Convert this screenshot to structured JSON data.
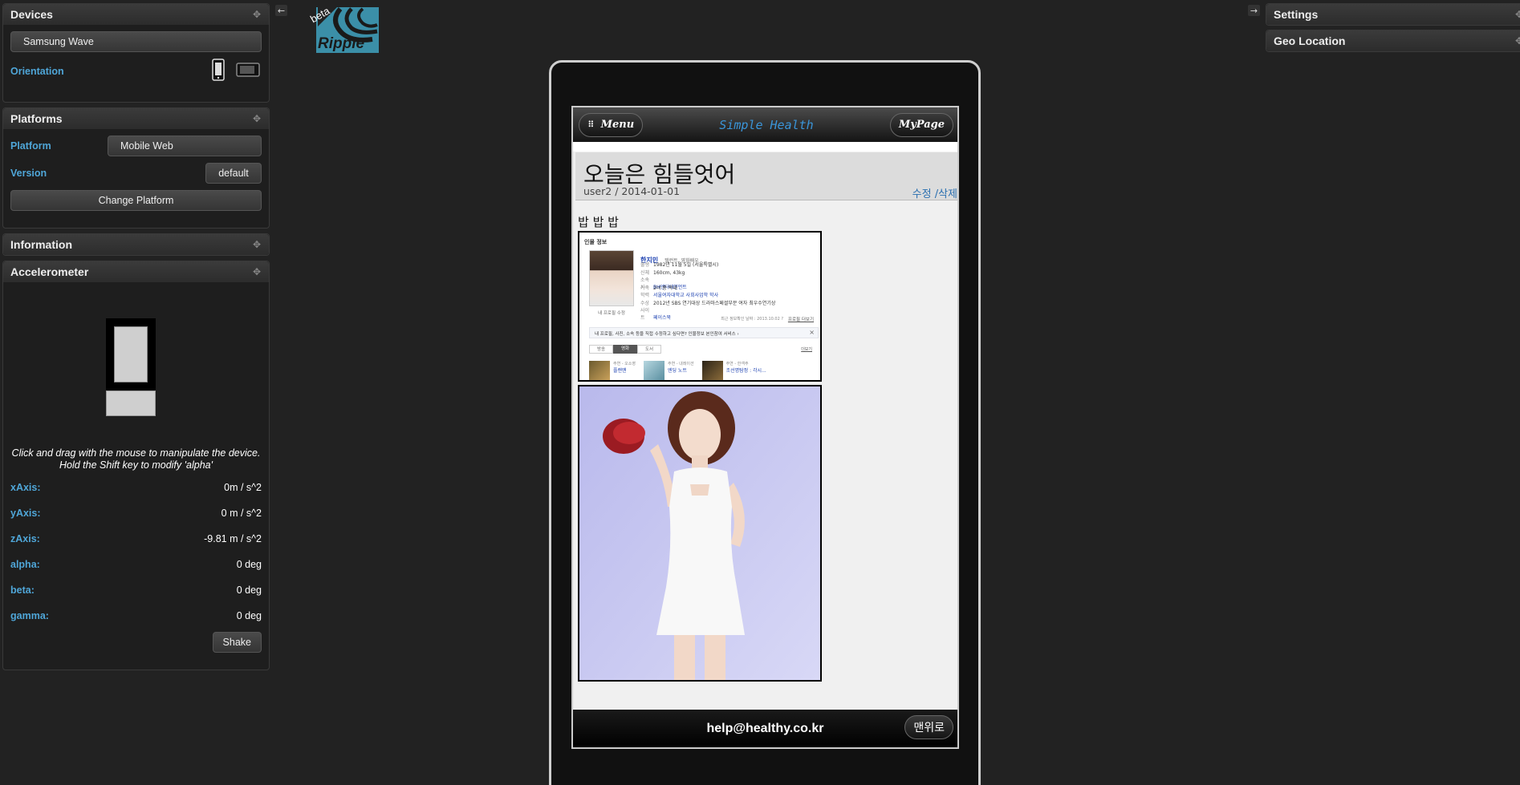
{
  "devices": {
    "title": "Devices",
    "device_name": "Samsung Wave",
    "orientation_label": "Orientation"
  },
  "platforms": {
    "title": "Platforms",
    "platform_label": "Platform",
    "platform_value": "Mobile Web",
    "version_label": "Version",
    "version_value": "default",
    "change_button": "Change Platform"
  },
  "information": {
    "title": "Information"
  },
  "accelerometer": {
    "title": "Accelerometer",
    "instruction_line1": "Click and drag with the mouse to manipulate the device.",
    "instruction_line2": "Hold the Shift key to modify 'alpha'",
    "rows": [
      {
        "label": "xAxis:",
        "value": "0m / s^2"
      },
      {
        "label": "yAxis:",
        "value": "0 m / s^2"
      },
      {
        "label": "zAxis:",
        "value": "-9.81 m / s^2"
      },
      {
        "label": "alpha:",
        "value": "0 deg"
      },
      {
        "label": "beta:",
        "value": "0 deg"
      },
      {
        "label": "gamma:",
        "value": "0 deg"
      }
    ],
    "shake_button": "Shake"
  },
  "right_panels": {
    "settings": "Settings",
    "geo": "Geo Location"
  },
  "logo": {
    "text": "Ripple",
    "badge": "beta",
    "color": "#3b8fa8"
  },
  "app": {
    "menu_button": "Menu",
    "title": "Simple Health",
    "mypage_button": "MyPage",
    "post_title": "오늘은 힘들엇어",
    "post_meta": "user2 / 2014-01-01",
    "post_edit": "수정 /삭제",
    "post_body": "밥 밥 밥",
    "footer_email": "help@healthy.co.kr",
    "top_button": "맨위로"
  },
  "profile_card": {
    "heading": "인물 정보",
    "name": "한지민",
    "name_sub": "탤런트, 영화배우",
    "photo_caption": "내 프로필 수정",
    "rows": [
      {
        "k": "출생",
        "v": "1982년 11월 5일 (서울특별시)"
      },
      {
        "k": "신체",
        "v": "160cm, 43kg"
      },
      {
        "k": "소속사",
        "v": "BH엔터테인먼트"
      },
      {
        "k": "가족",
        "v": "2녀 중 막내"
      },
      {
        "k": "학력",
        "v": "서울여자대학교 사회사업학 학사"
      },
      {
        "k": "수상",
        "v": "2012년 SBS 연기대상 드라마스페셜부문 여자 최우수연기상"
      },
      {
        "k": "사이트",
        "v": "페이스북"
      }
    ],
    "updated": "최근 정보확인 날짜 : 2013.10.02 ?",
    "more": "프로필 더보기",
    "notice": "내 프로필, 사진, 소속 등을 직접 수정하고 싶다면? 인물정보 본인참여 서비스 ›",
    "tabs": [
      "방송",
      "영화",
      "도서"
    ],
    "tabs_more": "더보기",
    "works": [
      {
        "role": "주연 - 오소영",
        "title": "플랜맨"
      },
      {
        "role": "주연 - 내레이션",
        "title": "엔딩 노트"
      },
      {
        "role": "주연 - 한객주",
        "title": "조선명탐정 : 각시..."
      }
    ]
  }
}
